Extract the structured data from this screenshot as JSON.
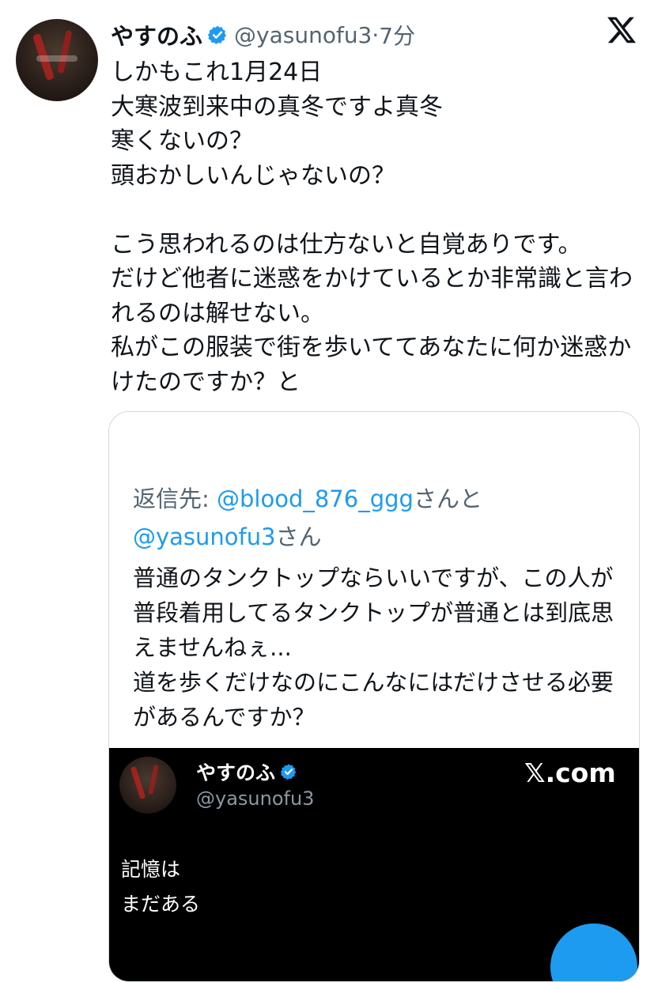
{
  "tweet": {
    "author_name": "やすのふ",
    "author_handle": "@yasunofu3",
    "separator": "·",
    "time": "7分",
    "text": "しかもこれ1月24日\n大寒波到来中の真冬ですよ真冬\n寒くないの？\n頭おかしいんじゃないの？\n\nこう思われるのは仕方ないと自覚ありです。\nだけど他者に迷惑をかけているとか非常識と言われるのは解せない。\n私がこの服装で街を歩いててあなたに何か迷惑かけたのですか？と"
  },
  "quote": {
    "reply_prefix": "返信先: ",
    "mention_1": "@blood_876_ggg",
    "san_1": "さんと",
    "mention_2": "@yasunofu3",
    "san_2": "さん",
    "text": "普通のタンクトップならいいですが、この人が普段着用してるタンクトップが普通とは到底思えませんねぇ...\n道を歩くだけなのにこんなにはだけさせる必要があるんですか？"
  },
  "embed": {
    "author_name": "やすのふ",
    "author_handle": "@yasunofu3",
    "brand": "𝕏.com",
    "text": "記憶は\nまだある"
  },
  "colors": {
    "accent": "#1d9bf0",
    "secondary_text": "#536471",
    "embed_bg": "#000000"
  },
  "icons": {
    "verified": "verified-badge-icon",
    "logo": "x-logo-icon"
  }
}
